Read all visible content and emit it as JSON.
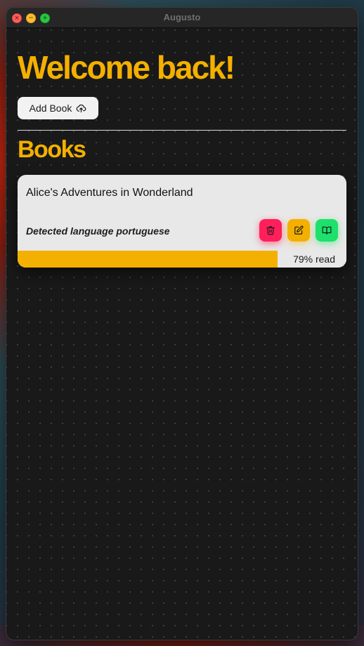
{
  "window": {
    "title": "Augusto"
  },
  "header": {
    "welcome": "Welcome back!",
    "add_book_label": "Add Book",
    "add_book_icon": "cloud-upload-icon"
  },
  "books_section": {
    "heading": "Books",
    "items": [
      {
        "title": "Alice's Adventures in Wonderland",
        "language_text": "Detected language portuguese",
        "progress": 0.79,
        "progress_label": "79% read",
        "actions": [
          {
            "name": "delete",
            "icon": "trash-icon",
            "color": "#ff1f5a"
          },
          {
            "name": "edit",
            "icon": "edit-icon",
            "color": "#f4b000"
          },
          {
            "name": "read",
            "icon": "book-open-icon",
            "color": "#1de16a"
          }
        ]
      }
    ]
  },
  "colors": {
    "accent": "#f4b000",
    "window_bg": "#191919",
    "card_bg": "#e8e8e8"
  }
}
